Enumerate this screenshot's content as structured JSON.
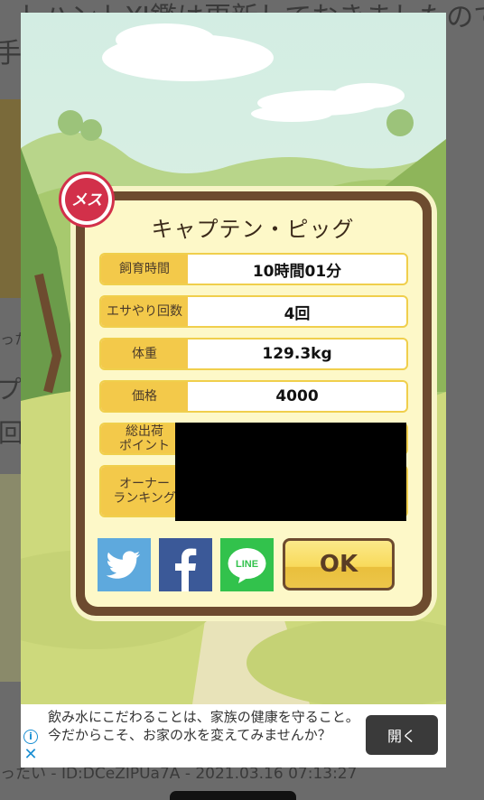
{
  "background": {
    "line1": "トハントⅪ鑑は更新しておきましたので、",
    "line2": "手読",
    "line3": "プテ",
    "line4": "回",
    "line5": "った",
    "footer": "ったい - ID:DCeZIPUa7A - 2021.03.16 07:13:27"
  },
  "dialog": {
    "gender_badge": "メス",
    "title": "キャプテン・ピッグ",
    "rows": [
      {
        "label": "飼育時間",
        "value": "10時間01分"
      },
      {
        "label": "エサやり回数",
        "value": "4回"
      },
      {
        "label": "体重",
        "value": "129.3kg"
      },
      {
        "label": "価格",
        "value": "4000"
      },
      {
        "label": "総出荷\nポイント",
        "value": ""
      },
      {
        "label": "オーナー\nランキング",
        "value": ""
      }
    ],
    "share": {
      "twitter_icon": "twitter-icon",
      "facebook_icon": "facebook-icon",
      "line_label": "LINE"
    },
    "ok_label": "OK"
  },
  "ad": {
    "text": "飲み水にこだわることは、家族の健康を守ること。今だからこそ、お家の水を変えてみませんか？",
    "button": "開く",
    "info_icon": "i",
    "close_icon": "✕"
  }
}
